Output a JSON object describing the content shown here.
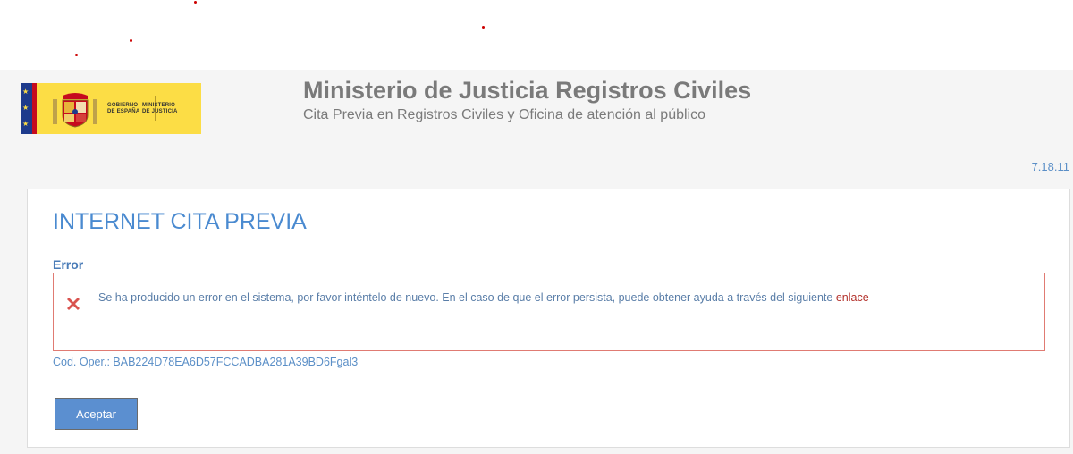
{
  "colors": {
    "accent": "#4a8ad0",
    "title_gray": "#7a7a7a",
    "error_border": "#e07b73",
    "error_icon": "#d9534f",
    "link": "#b3302a",
    "button_bg": "#5b8fd0"
  },
  "logo": {
    "gobierno_line1": "GOBIERNO",
    "gobierno_line2": "DE ESPAÑA",
    "ministerio_line1": "MINISTERIO",
    "ministerio_line2": "DE JUSTICIA"
  },
  "header": {
    "title": "Ministerio de Justicia Registros Civiles",
    "subtitle": "Cita Previa en Registros Civiles y Oficina de atención al público",
    "version": "7.18.11"
  },
  "panel": {
    "title": "INTERNET CITA PREVIA",
    "error_label": "Error",
    "error_icon": "close-x-icon",
    "error_message": "Se ha producido un error en el sistema, por favor inténtelo de nuevo. En el caso de que el error persista, puede obtener ayuda a través del siguiente ",
    "error_link_text": "enlace",
    "cod_oper": "Cod. Oper.: BAB224D78EA6D57FCCADBA281A39BD6Fgal3",
    "accept_button": "Aceptar"
  }
}
